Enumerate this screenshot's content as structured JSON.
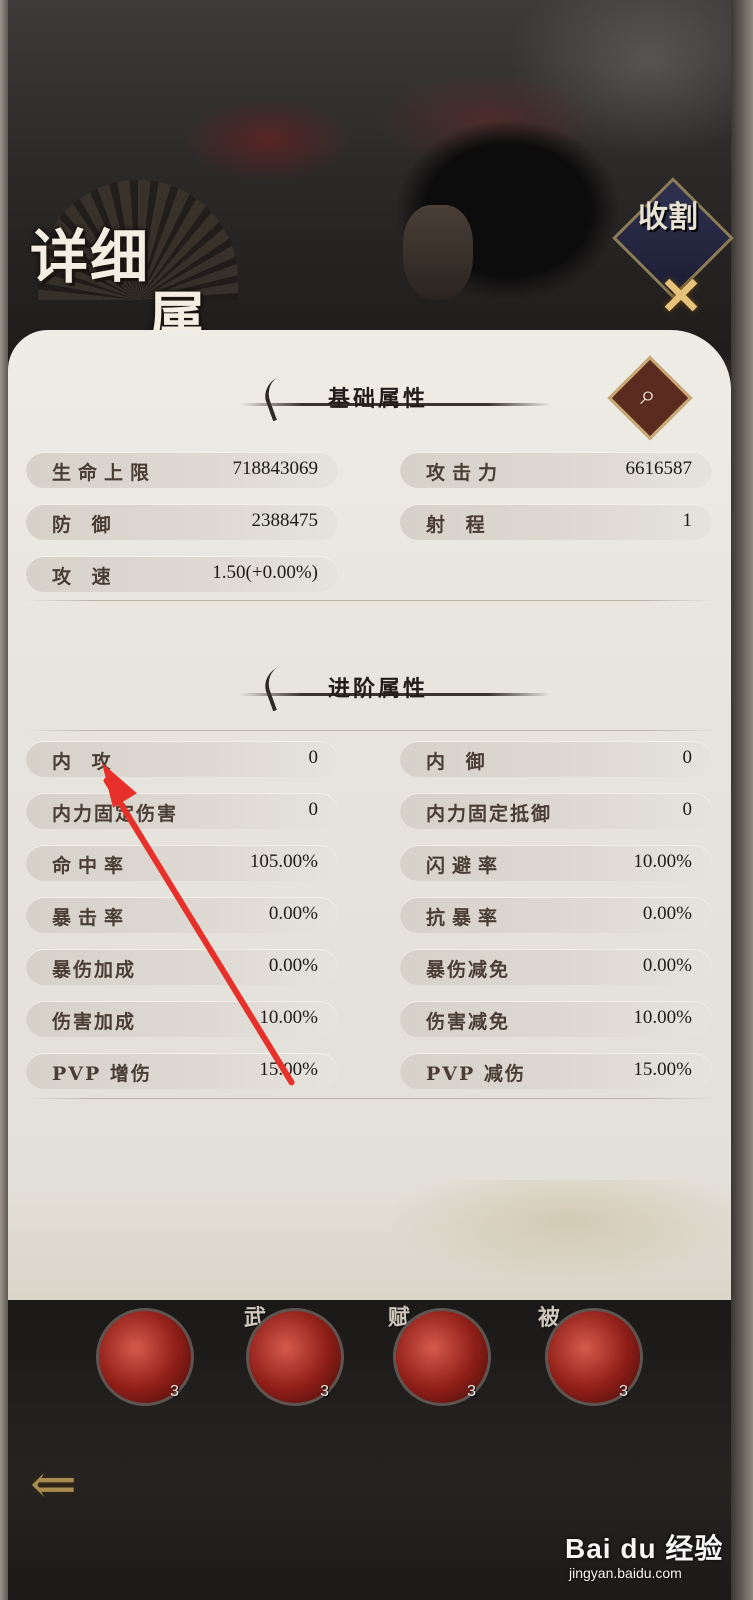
{
  "header": {
    "title_line1": "详细",
    "title_line2": "属性",
    "badge_label": "收割",
    "close_glyph": "✕"
  },
  "basic": {
    "title": "基础属性",
    "search_glyph": "⌕",
    "stats": [
      {
        "label": "生命上限",
        "value": "718843069"
      },
      {
        "label": "攻击力",
        "value": "6616587"
      },
      {
        "label": "防 御",
        "value": "2388475"
      },
      {
        "label": "射 程",
        "value": "1"
      },
      {
        "label": "攻 速",
        "value": "1.50(+0.00%)"
      }
    ]
  },
  "advanced": {
    "title": "进阶属性",
    "stats": [
      {
        "label": "内 攻",
        "value": "0"
      },
      {
        "label": "内 御",
        "value": "0"
      },
      {
        "label": "内力固定伤害",
        "value": "0"
      },
      {
        "label": "内力固定抵御",
        "value": "0"
      },
      {
        "label": "命中率",
        "value": "105.00%"
      },
      {
        "label": "闪避率",
        "value": "10.00%"
      },
      {
        "label": "暴击率",
        "value": "0.00%"
      },
      {
        "label": "抗暴率",
        "value": "0.00%"
      },
      {
        "label": "暴伤加成",
        "value": "0.00%"
      },
      {
        "label": "暴伤减免",
        "value": "0.00%"
      },
      {
        "label": "伤害加成",
        "value": "10.00%"
      },
      {
        "label": "伤害减免",
        "value": "10.00%"
      },
      {
        "label": "PVP 增伤",
        "value": "15.00%"
      },
      {
        "label": "PVP 减伤",
        "value": "15.00%"
      }
    ]
  },
  "skills": [
    {
      "tag": "",
      "level": "3"
    },
    {
      "tag": "武",
      "level": "3"
    },
    {
      "tag": "赋",
      "level": "3"
    },
    {
      "tag": "被",
      "level": "3"
    }
  ],
  "footer": {
    "back_glyph": "⇐",
    "watermark_brand": "Bai du 经验",
    "watermark_url": "jingyan.baidu.com"
  },
  "colors": {
    "panel_bg": "#e7e4de",
    "stat_label": "#4a3d34",
    "annotation_arrow": "#e8302a",
    "skill_red": "#8d1d17",
    "gold_accent": "#c9a875"
  }
}
